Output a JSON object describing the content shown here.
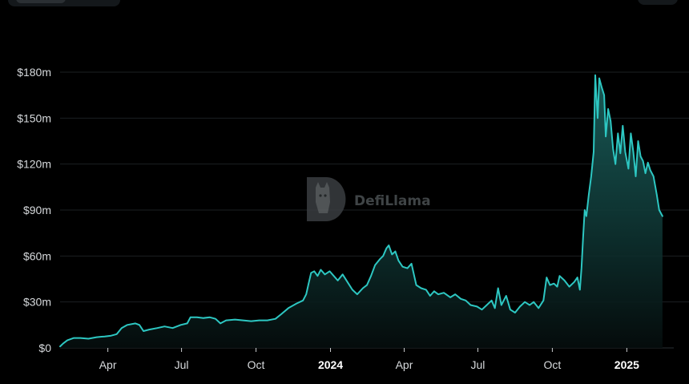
{
  "watermark": {
    "text": "DefiLlama",
    "icon": "llama-logo-icon"
  },
  "controls": {
    "top_left": "toggle-button",
    "top_right": "menu-button"
  },
  "colors": {
    "background": "#000000",
    "line": "#2dc7c2",
    "area_top": "#1a5f5c",
    "grid": "#1b1f22",
    "tick_text": "#d6d9dc"
  },
  "chart_data": {
    "type": "area",
    "title": "",
    "xlabel": "",
    "ylabel": "",
    "ylim": [
      0,
      180
    ],
    "y_unit": "m",
    "y_prefix": "$",
    "y_ticks": [
      0,
      30,
      60,
      90,
      120,
      150,
      180
    ],
    "y_tick_labels": [
      "$0",
      "$30m",
      "$60m",
      "$90m",
      "$120m",
      "$150m",
      "$180m"
    ],
    "x_range": [
      "2023-02-01",
      "2025-02-28"
    ],
    "x_ticks": [
      {
        "date": "2023-04-01",
        "label": "Apr",
        "bold": false
      },
      {
        "date": "2023-07-01",
        "label": "Jul",
        "bold": false
      },
      {
        "date": "2023-10-01",
        "label": "Oct",
        "bold": false
      },
      {
        "date": "2024-01-01",
        "label": "2024",
        "bold": true
      },
      {
        "date": "2024-04-01",
        "label": "Apr",
        "bold": false
      },
      {
        "date": "2024-07-01",
        "label": "Jul",
        "bold": false
      },
      {
        "date": "2024-10-01",
        "label": "Oct",
        "bold": false
      },
      {
        "date": "2025-01-01",
        "label": "2025",
        "bold": true
      }
    ],
    "grid": "horizontal",
    "legend": "none",
    "series": [
      {
        "points": [
          [
            "2023-02-01",
            1
          ],
          [
            "2023-02-05",
            3
          ],
          [
            "2023-02-10",
            5
          ],
          [
            "2023-02-18",
            6.5
          ],
          [
            "2023-02-26",
            6.5
          ],
          [
            "2023-03-08",
            6
          ],
          [
            "2023-03-18",
            7
          ],
          [
            "2023-03-28",
            7.5
          ],
          [
            "2023-04-05",
            8
          ],
          [
            "2023-04-12",
            9
          ],
          [
            "2023-04-18",
            13
          ],
          [
            "2023-04-25",
            15
          ],
          [
            "2023-05-05",
            16
          ],
          [
            "2023-05-10",
            15
          ],
          [
            "2023-05-15",
            11
          ],
          [
            "2023-05-22",
            12
          ],
          [
            "2023-06-01",
            13
          ],
          [
            "2023-06-10",
            14
          ],
          [
            "2023-06-20",
            13
          ],
          [
            "2023-06-30",
            15
          ],
          [
            "2023-07-08",
            16
          ],
          [
            "2023-07-12",
            20
          ],
          [
            "2023-07-20",
            20
          ],
          [
            "2023-07-28",
            19.5
          ],
          [
            "2023-08-05",
            20
          ],
          [
            "2023-08-12",
            19
          ],
          [
            "2023-08-18",
            16
          ],
          [
            "2023-08-25",
            18
          ],
          [
            "2023-09-05",
            18.5
          ],
          [
            "2023-09-15",
            18
          ],
          [
            "2023-09-25",
            17.5
          ],
          [
            "2023-10-05",
            18
          ],
          [
            "2023-10-15",
            18
          ],
          [
            "2023-10-25",
            19
          ],
          [
            "2023-11-01",
            22
          ],
          [
            "2023-11-10",
            26
          ],
          [
            "2023-11-20",
            29
          ],
          [
            "2023-11-28",
            31
          ],
          [
            "2023-12-02",
            35
          ],
          [
            "2023-12-05",
            42
          ],
          [
            "2023-12-08",
            49
          ],
          [
            "2023-12-12",
            50
          ],
          [
            "2023-12-16",
            47
          ],
          [
            "2023-12-20",
            51
          ],
          [
            "2023-12-25",
            48
          ],
          [
            "2023-12-31",
            50
          ],
          [
            "2024-01-05",
            47
          ],
          [
            "2024-01-10",
            44
          ],
          [
            "2024-01-16",
            48
          ],
          [
            "2024-01-22",
            43
          ],
          [
            "2024-01-28",
            38
          ],
          [
            "2024-02-03",
            35
          ],
          [
            "2024-02-10",
            39
          ],
          [
            "2024-02-15",
            41
          ],
          [
            "2024-02-20",
            47
          ],
          [
            "2024-02-25",
            54
          ],
          [
            "2024-03-02",
            58
          ],
          [
            "2024-03-06",
            60
          ],
          [
            "2024-03-10",
            65
          ],
          [
            "2024-03-13",
            67
          ],
          [
            "2024-03-17",
            61
          ],
          [
            "2024-03-21",
            63
          ],
          [
            "2024-03-25",
            57
          ],
          [
            "2024-03-30",
            53
          ],
          [
            "2024-04-05",
            52
          ],
          [
            "2024-04-10",
            55
          ],
          [
            "2024-04-13",
            48
          ],
          [
            "2024-04-16",
            41
          ],
          [
            "2024-04-22",
            39
          ],
          [
            "2024-04-28",
            38
          ],
          [
            "2024-05-03",
            34
          ],
          [
            "2024-05-08",
            37
          ],
          [
            "2024-05-13",
            35
          ],
          [
            "2024-05-20",
            36
          ],
          [
            "2024-05-28",
            33
          ],
          [
            "2024-06-03",
            35
          ],
          [
            "2024-06-10",
            32
          ],
          [
            "2024-06-16",
            31
          ],
          [
            "2024-06-22",
            28
          ],
          [
            "2024-06-30",
            27
          ],
          [
            "2024-07-06",
            25
          ],
          [
            "2024-07-12",
            28
          ],
          [
            "2024-07-18",
            31
          ],
          [
            "2024-07-22",
            26
          ],
          [
            "2024-07-26",
            39
          ],
          [
            "2024-07-30",
            28
          ],
          [
            "2024-08-05",
            34
          ],
          [
            "2024-08-10",
            25
          ],
          [
            "2024-08-16",
            23
          ],
          [
            "2024-08-22",
            27
          ],
          [
            "2024-08-28",
            30
          ],
          [
            "2024-09-03",
            28
          ],
          [
            "2024-09-08",
            30
          ],
          [
            "2024-09-14",
            26
          ],
          [
            "2024-09-20",
            31
          ],
          [
            "2024-09-24",
            46
          ],
          [
            "2024-09-28",
            41
          ],
          [
            "2024-10-03",
            42
          ],
          [
            "2024-10-07",
            40
          ],
          [
            "2024-10-10",
            47
          ],
          [
            "2024-10-16",
            44
          ],
          [
            "2024-10-22",
            40
          ],
          [
            "2024-10-28",
            43
          ],
          [
            "2024-11-01",
            46
          ],
          [
            "2024-11-04",
            38
          ],
          [
            "2024-11-06",
            52
          ],
          [
            "2024-11-08",
            72
          ],
          [
            "2024-11-10",
            90
          ],
          [
            "2024-11-12",
            86
          ],
          [
            "2024-11-15",
            100
          ],
          [
            "2024-11-18",
            112
          ],
          [
            "2024-11-21",
            128
          ],
          [
            "2024-11-23",
            178
          ],
          [
            "2024-11-26",
            150
          ],
          [
            "2024-11-28",
            176
          ],
          [
            "2024-12-01",
            170
          ],
          [
            "2024-12-04",
            165
          ],
          [
            "2024-12-06",
            138
          ],
          [
            "2024-12-09",
            156
          ],
          [
            "2024-12-12",
            148
          ],
          [
            "2024-12-15",
            130
          ],
          [
            "2024-12-18",
            120
          ],
          [
            "2024-12-21",
            140
          ],
          [
            "2024-12-24",
            127
          ],
          [
            "2024-12-27",
            145
          ],
          [
            "2024-12-30",
            128
          ],
          [
            "2025-01-03",
            117
          ],
          [
            "2025-01-06",
            140
          ],
          [
            "2025-01-09",
            128
          ],
          [
            "2025-01-12",
            112
          ],
          [
            "2025-01-15",
            135
          ],
          [
            "2025-01-18",
            125
          ],
          [
            "2025-01-21",
            122
          ],
          [
            "2025-01-24",
            114
          ],
          [
            "2025-01-27",
            121
          ],
          [
            "2025-01-30",
            116
          ],
          [
            "2025-02-03",
            112
          ],
          [
            "2025-02-07",
            100
          ],
          [
            "2025-02-10",
            90
          ],
          [
            "2025-02-14",
            86
          ]
        ]
      }
    ]
  }
}
